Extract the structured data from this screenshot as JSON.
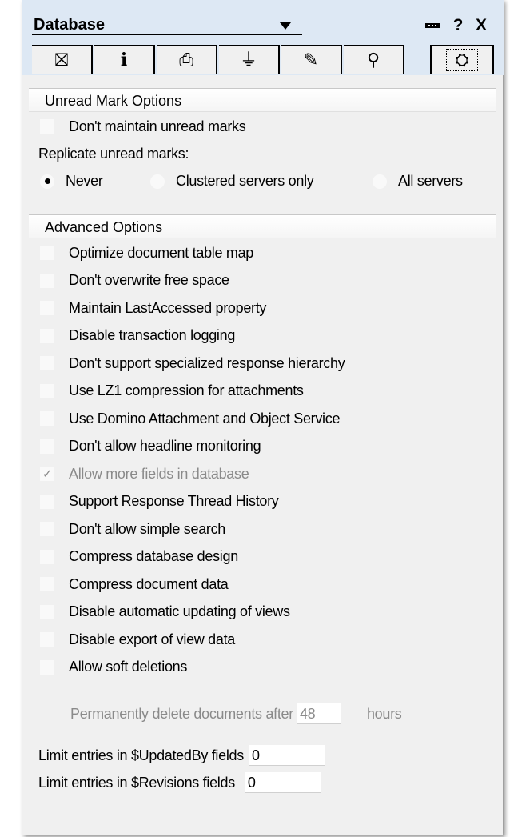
{
  "window": {
    "title": "Database",
    "help_label": "?",
    "close_label": "X"
  },
  "tabs": [
    {
      "icon": "database-basics-icon",
      "glyph": "⛝",
      "active": false
    },
    {
      "icon": "info-icon",
      "glyph": "i",
      "active": false
    },
    {
      "icon": "print-icon",
      "glyph": "⎙",
      "active": false
    },
    {
      "icon": "design-icon",
      "glyph": "⏚",
      "active": false
    },
    {
      "icon": "launch-icon",
      "glyph": "✎",
      "active": false
    },
    {
      "icon": "full-text-search-icon",
      "glyph": "⚲",
      "active": false
    },
    {
      "icon": "advanced-icon",
      "glyph": "⛭",
      "active": true
    }
  ],
  "unread": {
    "header": "Unread Mark Options",
    "dont_maintain": "Don't maintain unread marks",
    "replicate_label": "Replicate unread marks:",
    "radio_never": "Never",
    "radio_clustered": "Clustered servers only",
    "radio_all": "All servers",
    "selected": "Never"
  },
  "advanced": {
    "header": "Advanced Options",
    "options": [
      {
        "label": "Optimize document table map",
        "checked": false,
        "enabled": true
      },
      {
        "label": "Don't overwrite free space",
        "checked": false,
        "enabled": true
      },
      {
        "label": "Maintain LastAccessed property",
        "checked": false,
        "enabled": true
      },
      {
        "label": "Disable transaction logging",
        "checked": false,
        "enabled": true
      },
      {
        "label": "Don't support specialized response hierarchy",
        "checked": false,
        "enabled": true
      },
      {
        "label": "Use LZ1 compression for attachments",
        "checked": false,
        "enabled": true
      },
      {
        "label": "Use Domino Attachment and Object Service",
        "checked": false,
        "enabled": true
      },
      {
        "label": "Don't allow headline monitoring",
        "checked": false,
        "enabled": true
      },
      {
        "label": "Allow more fields in database",
        "checked": true,
        "enabled": false
      },
      {
        "label": "Support Response Thread History",
        "checked": false,
        "enabled": true
      },
      {
        "label": "Don't allow simple search",
        "checked": false,
        "enabled": true
      },
      {
        "label": "Compress database design",
        "checked": false,
        "enabled": true
      },
      {
        "label": "Compress document data",
        "checked": false,
        "enabled": true
      },
      {
        "label": "Disable automatic updating of views",
        "checked": false,
        "enabled": true
      },
      {
        "label": "Disable export of view data",
        "checked": false,
        "enabled": true
      },
      {
        "label": "Allow soft deletions",
        "checked": false,
        "enabled": true
      }
    ],
    "delete_after_label": "Permanently delete documents after",
    "delete_after_value": "48",
    "hours_label": "hours",
    "updatedby_label": "Limit entries in $UpdatedBy fields",
    "updatedby_value": "0",
    "revisions_label": "Limit entries in $Revisions fields",
    "revisions_value": "0"
  }
}
